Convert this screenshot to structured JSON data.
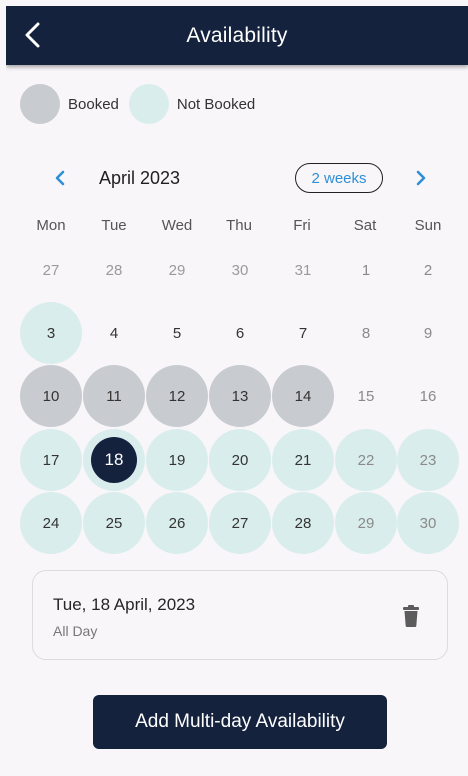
{
  "header": {
    "title": "Availability",
    "back_icon": "chevron-left-icon"
  },
  "legend": [
    {
      "label": "Booked",
      "color": "#c8cbd0"
    },
    {
      "label": "Not Booked",
      "color": "#daeded"
    }
  ],
  "calendar": {
    "month_label": "April 2023",
    "view_toggle": "2 weeks",
    "prev_icon": "chevron-left-icon",
    "next_icon": "chevron-right-icon",
    "accent_color": "#2f8fd6",
    "weekdays": [
      "Mon",
      "Tue",
      "Wed",
      "Thu",
      "Fri",
      "Sat",
      "Sun"
    ],
    "weeks": [
      [
        {
          "day": "27",
          "status": "outside"
        },
        {
          "day": "28",
          "status": "outside"
        },
        {
          "day": "29",
          "status": "outside"
        },
        {
          "day": "30",
          "status": "outside"
        },
        {
          "day": "31",
          "status": "outside"
        },
        {
          "day": "1",
          "status": "none"
        },
        {
          "day": "2",
          "status": "none"
        }
      ],
      [
        {
          "day": "3",
          "status": "not_booked"
        },
        {
          "day": "4",
          "status": "none"
        },
        {
          "day": "5",
          "status": "none"
        },
        {
          "day": "6",
          "status": "none"
        },
        {
          "day": "7",
          "status": "none"
        },
        {
          "day": "8",
          "status": "none"
        },
        {
          "day": "9",
          "status": "none"
        }
      ],
      [
        {
          "day": "10",
          "status": "booked"
        },
        {
          "day": "11",
          "status": "booked"
        },
        {
          "day": "12",
          "status": "booked"
        },
        {
          "day": "13",
          "status": "booked"
        },
        {
          "day": "14",
          "status": "booked"
        },
        {
          "day": "15",
          "status": "none"
        },
        {
          "day": "16",
          "status": "none"
        }
      ],
      [
        {
          "day": "17",
          "status": "not_booked"
        },
        {
          "day": "18",
          "status": "selected"
        },
        {
          "day": "19",
          "status": "not_booked"
        },
        {
          "day": "20",
          "status": "not_booked"
        },
        {
          "day": "21",
          "status": "not_booked"
        },
        {
          "day": "22",
          "status": "not_booked"
        },
        {
          "day": "23",
          "status": "not_booked"
        }
      ],
      [
        {
          "day": "24",
          "status": "not_booked"
        },
        {
          "day": "25",
          "status": "not_booked"
        },
        {
          "day": "26",
          "status": "not_booked"
        },
        {
          "day": "27",
          "status": "not_booked"
        },
        {
          "day": "28",
          "status": "not_booked"
        },
        {
          "day": "29",
          "status": "not_booked"
        },
        {
          "day": "30",
          "status": "not_booked"
        }
      ]
    ]
  },
  "selected_card": {
    "date": "Tue, 18 April, 2023",
    "subtitle": "All Day",
    "delete_icon": "trash-icon"
  },
  "actions": {
    "primary_label": "Add Multi-day Availability"
  },
  "colors": {
    "navy": "#14223e",
    "booked": "#c8cbd0",
    "not_booked": "#daeded"
  }
}
